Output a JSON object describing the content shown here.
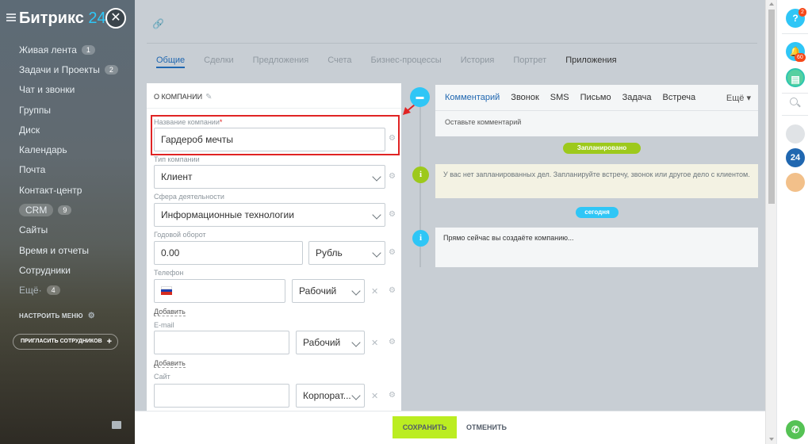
{
  "sidebar": {
    "logo_text": "Битрикс",
    "logo_num": "24",
    "items": [
      {
        "label": "Живая лента",
        "count": "1"
      },
      {
        "label": "Задачи и Проекты",
        "count": "2"
      },
      {
        "label": "Чат и звонки"
      },
      {
        "label": "Группы"
      },
      {
        "label": "Диск"
      },
      {
        "label": "Календарь"
      },
      {
        "label": "Почта"
      },
      {
        "label": "Контакт-центр"
      },
      {
        "label": "CRM",
        "count": "9"
      },
      {
        "label": "Сайты"
      },
      {
        "label": "Время и отчеты"
      },
      {
        "label": "Сотрудники"
      },
      {
        "label": "Ещё",
        "count": "4"
      }
    ],
    "configure_label": "НАСТРОИТЬ МЕНЮ",
    "invite_label": "ПРИГЛАСИТЬ СОТРУДНИКОВ"
  },
  "tabs": [
    "Общие",
    "Сделки",
    "Предложения",
    "Счета",
    "Бизнес-процессы",
    "История",
    "Портрет",
    "Приложения"
  ],
  "form": {
    "section_title": "О КОМПАНИИ",
    "company_name": {
      "label": "Название компании",
      "required_mark": "*",
      "value": "Гардероб мечты"
    },
    "company_type": {
      "label": "Тип компании",
      "value": "Клиент"
    },
    "industry": {
      "label": "Сфера деятельности",
      "value": "Информационные технологии"
    },
    "revenue": {
      "label": "Годовой оборот",
      "value": "0.00",
      "currency": "Рубль"
    },
    "phone": {
      "label": "Телефон",
      "value": "",
      "type": "Рабочий"
    },
    "add_phone": "Добавить",
    "email": {
      "label": "E-mail",
      "value": "",
      "type": "Рабочий"
    },
    "add_email": "Добавить",
    "site": {
      "label": "Сайт",
      "value": "",
      "type": "Корпорат..."
    }
  },
  "timeline": {
    "tabs": [
      "Комментарий",
      "Звонок",
      "SMS",
      "Письмо",
      "Задача",
      "Встреча"
    ],
    "more": "Ещё",
    "comment_placeholder": "Оставьте комментарий",
    "planned_badge": "Запланировано",
    "planned_text": "У вас нет запланированных дел. Запланируйте встречу, звонок или другое дело с клиентом.",
    "today_badge": "сегодня",
    "now_text": "Прямо сейчас вы создаёте компанию..."
  },
  "footer": {
    "save_label": "СОХРАНИТЬ",
    "cancel_label": "ОТМЕНИТЬ"
  },
  "right_panel": {
    "help_label": "?",
    "help_badge": "2",
    "notifications_badge": "60",
    "b24_label": "24"
  },
  "colors": {
    "accent_blue": "#2067b0",
    "save_green": "#bbed21",
    "planned_green": "#9dc91c",
    "today_blue": "#2fc6f6",
    "highlight_red": "#e02424"
  }
}
